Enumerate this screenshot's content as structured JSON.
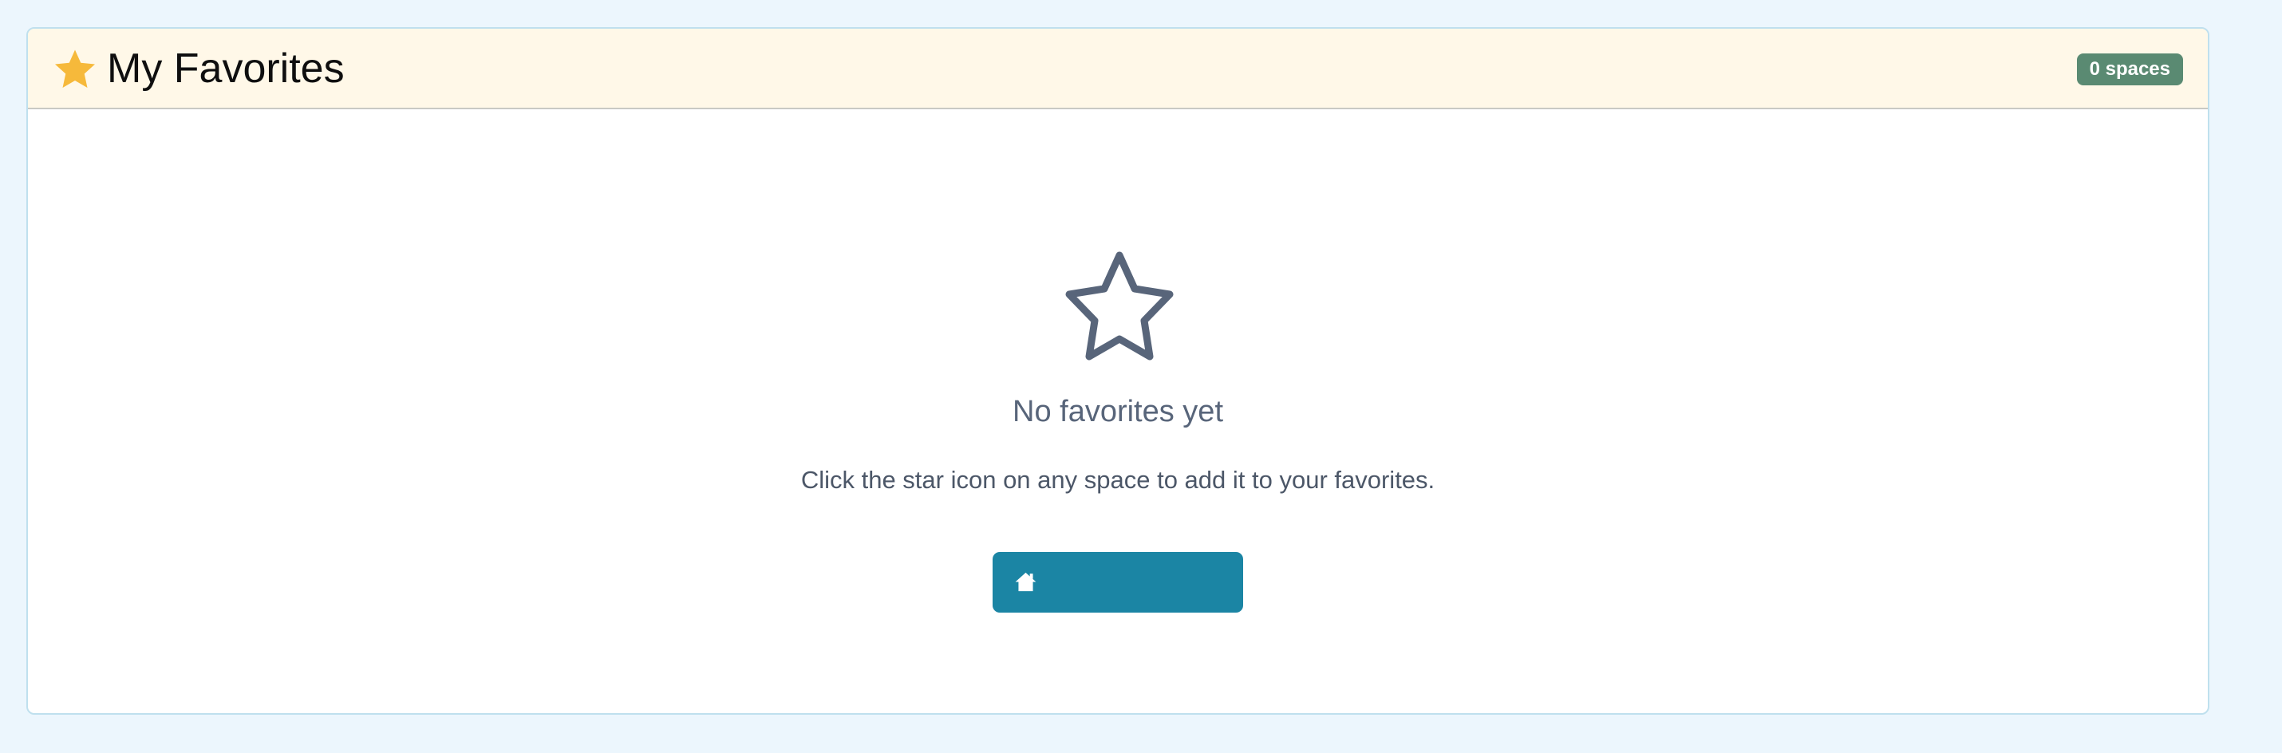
{
  "header": {
    "title": "My Favorites",
    "icon": "star-icon",
    "count_badge": "0 spaces"
  },
  "empty_state": {
    "icon": "star-outline-icon",
    "title": "No favorites yet",
    "message": "Click the star icon on any space to add it to your favorites.",
    "button": {
      "icon": "home-icon",
      "label": ""
    }
  },
  "colors": {
    "page_background": "#ecf6fd",
    "header_background": "#fff8e8",
    "header_star": "#f6b93b",
    "badge_background": "#5a8a72",
    "empty_star_stroke": "#58657a",
    "button_background": "#1b85a4"
  }
}
